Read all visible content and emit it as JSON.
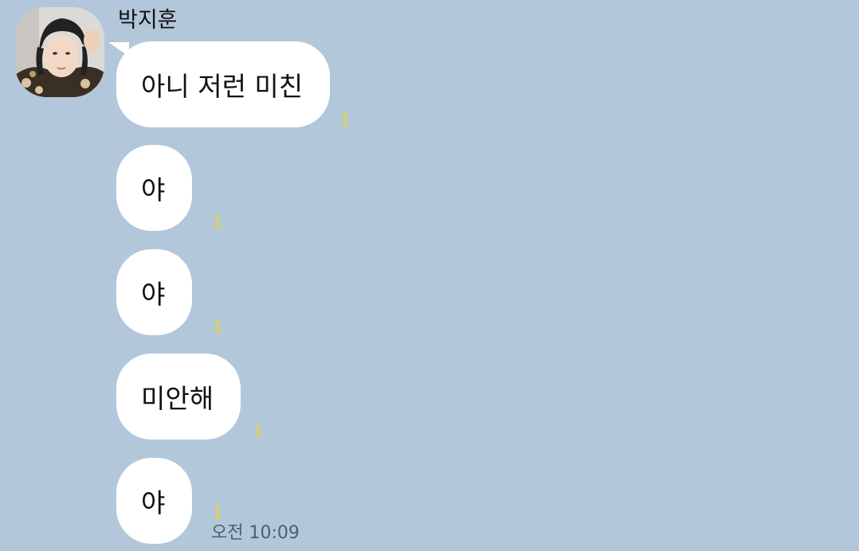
{
  "chat": {
    "sender_name": "박지훈",
    "messages": [
      {
        "text": "아니 저런 미친",
        "unread": "1"
      },
      {
        "text": "야",
        "unread": "1"
      },
      {
        "text": "야",
        "unread": "1"
      },
      {
        "text": "미안해",
        "unread": "1"
      },
      {
        "text": "야",
        "unread": "1"
      }
    ],
    "last_time": "오전 10:09"
  },
  "colors": {
    "background": "#b2c7da",
    "bubble": "#ffffff",
    "unread": "#f2d22e",
    "time": "#4f5f6e"
  },
  "icons": {
    "avatar": "profile-photo"
  }
}
